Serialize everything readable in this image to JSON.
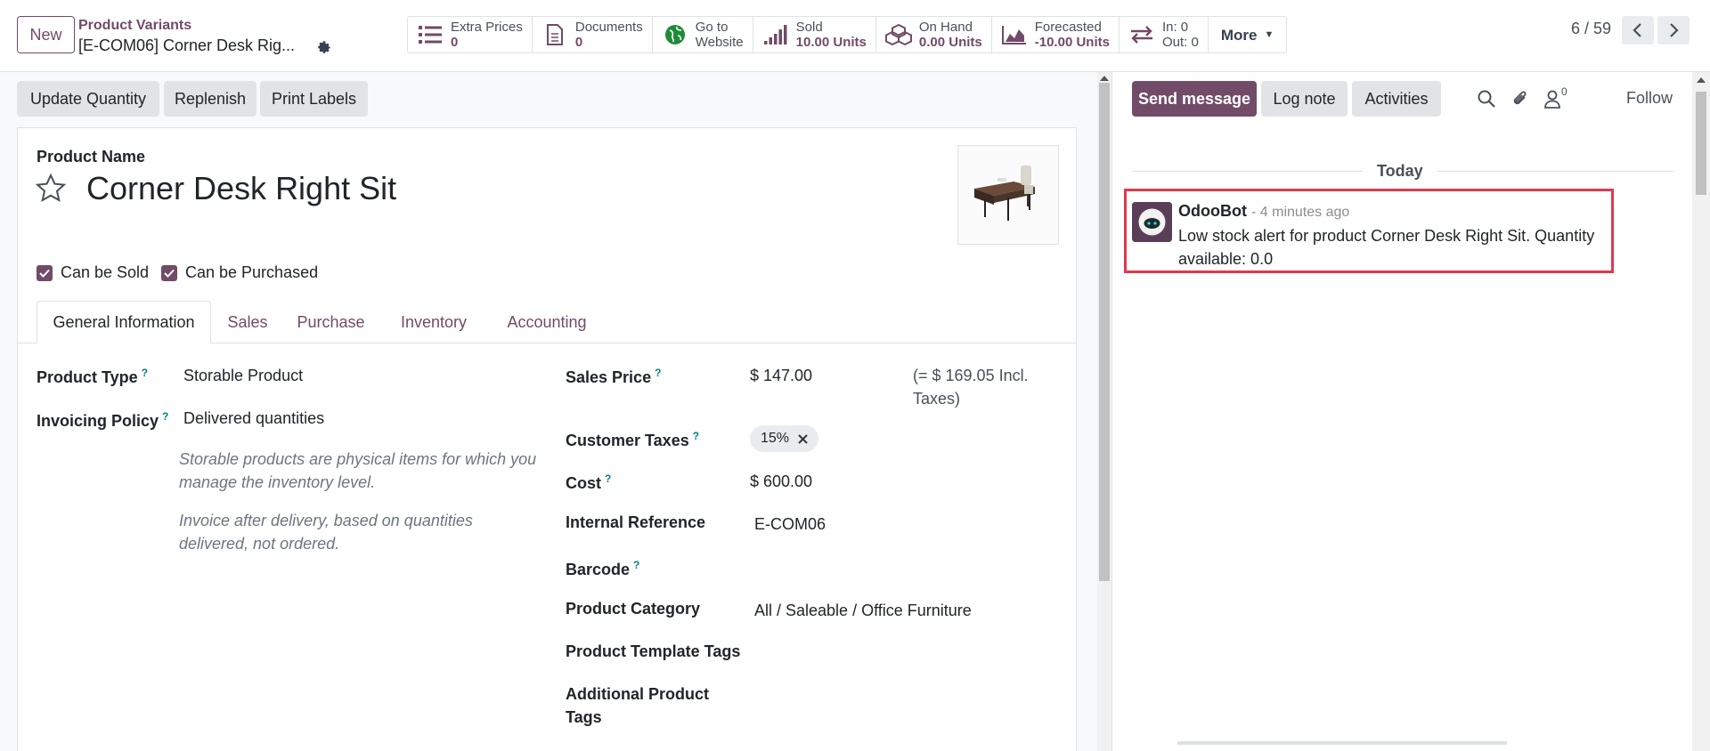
{
  "topbar": {
    "new_label": "New",
    "breadcrumb_parent": "Product Variants",
    "breadcrumb_current": "[E-COM06] Corner Desk Rig...",
    "smart_buttons": [
      {
        "icon": "list-icon",
        "line1": "Extra Prices",
        "line2": "0"
      },
      {
        "icon": "document-icon",
        "line1": "Documents",
        "line2": "0"
      },
      {
        "icon": "globe-icon",
        "line1": "Go to",
        "line2": "Website"
      },
      {
        "icon": "signal-bars-icon",
        "line1": "Sold",
        "line2": "10.00 Units"
      },
      {
        "icon": "cubes-icon",
        "line1": "On Hand",
        "line2": "0.00 Units"
      },
      {
        "icon": "area-chart-icon",
        "line1": "Forecasted",
        "line2": "-10.00 Units"
      },
      {
        "icon": "exchange-icon",
        "line1": "In: 0",
        "line2": "Out: 0"
      }
    ],
    "more_label": "More",
    "pager": "6 / 59"
  },
  "actions": {
    "update_quantity": "Update Quantity",
    "replenish": "Replenish",
    "print_labels": "Print Labels"
  },
  "form": {
    "product_name_label": "Product Name",
    "product_name": "Corner Desk Right Sit",
    "can_be_sold": "Can be Sold",
    "can_be_purchased": "Can be Purchased",
    "tabs": [
      "General Information",
      "Sales",
      "Purchase",
      "Inventory",
      "Accounting"
    ],
    "help_mark": "?",
    "left_fields": {
      "product_type_label": "Product Type",
      "product_type": "Storable Product",
      "invoicing_policy_label": "Invoicing Policy",
      "invoicing_policy": "Delivered quantities",
      "help1": "Storable products are physical items for which you manage the inventory level.",
      "help2": "Invoice after delivery, based on quantities delivered, not ordered."
    },
    "right_fields": {
      "sales_price_label": "Sales Price",
      "sales_price": "$ 147.00",
      "incl_taxes": "(= $ 169.05 Incl. Taxes)",
      "customer_taxes_label": "Customer Taxes",
      "customer_tax_tag": "15%",
      "cost_label": "Cost",
      "cost": "$ 600.00",
      "internal_reference_label": "Internal Reference",
      "internal_reference": "E-COM06",
      "barcode_label": "Barcode",
      "product_category_label": "Product Category",
      "product_category": "All / Saleable / Office Furniture",
      "product_template_tags_label": "Product Template Tags",
      "additional_product_tags_label": "Additional Product Tags"
    }
  },
  "chatter": {
    "send_message": "Send message",
    "log_note": "Log note",
    "activities": "Activities",
    "follower_count": "0",
    "follow": "Follow",
    "today": "Today",
    "message": {
      "author": "OdooBot",
      "time": "- 4 minutes ago",
      "body": "Low stock alert for product Corner Desk Right Sit. Quantity available: 0.0"
    }
  },
  "colors": {
    "brand": "#714b67",
    "highlight": "#e0384d",
    "help_link": "#017e84"
  }
}
